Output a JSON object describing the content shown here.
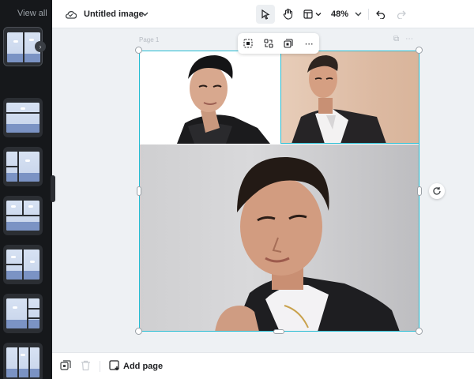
{
  "sidebar": {
    "view_all": "View all"
  },
  "topbar": {
    "title": "Untitled image",
    "zoom": "48%"
  },
  "canvas": {
    "page_label": "Page 1"
  },
  "bottombar": {
    "add_page": "Add page"
  },
  "colors": {
    "selection": "#26bcd2",
    "sidebar_bg": "#16181b",
    "canvas_bg": "#eef1f4"
  }
}
